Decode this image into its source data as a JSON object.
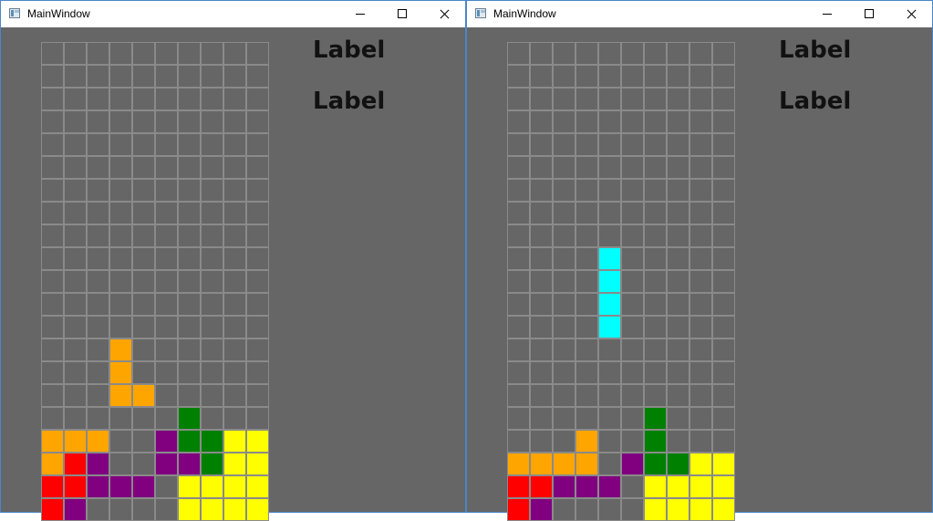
{
  "colors": {
    "O": "#ffa500",
    "R": "#ff0000",
    "P": "#800080",
    "G": "#008000",
    "Y": "#ffff00",
    "C": "#00ffff",
    "empty": "#666666"
  },
  "windows": [
    {
      "title": "MainWindow",
      "labels": [
        "Label",
        "Label"
      ],
      "grid": [
        "..........",
        "..........",
        "..........",
        "..........",
        "..........",
        "..........",
        "..........",
        "..........",
        "..........",
        "..........",
        "..........",
        "..........",
        "..........",
        "...O......",
        "...O......",
        "...OO.....",
        "......G...",
        "OOO..PGGYY",
        "ORP..PPGYY",
        "RRPPP.YYYY",
        "RP....YYYY"
      ]
    },
    {
      "title": "MainWindow",
      "labels": [
        "Label",
        "Label"
      ],
      "grid": [
        "..........",
        "..........",
        "..........",
        "..........",
        "..........",
        "..........",
        "..........",
        "..........",
        "..........",
        "....C.....",
        "....C.....",
        "....C.....",
        "....C.....",
        "..........",
        "..........",
        "..........",
        "......G...",
        "...O..G...",
        "OOOO.PGGYY",
        "RRPPP.YYYY",
        "RP....YYYY"
      ]
    }
  ]
}
